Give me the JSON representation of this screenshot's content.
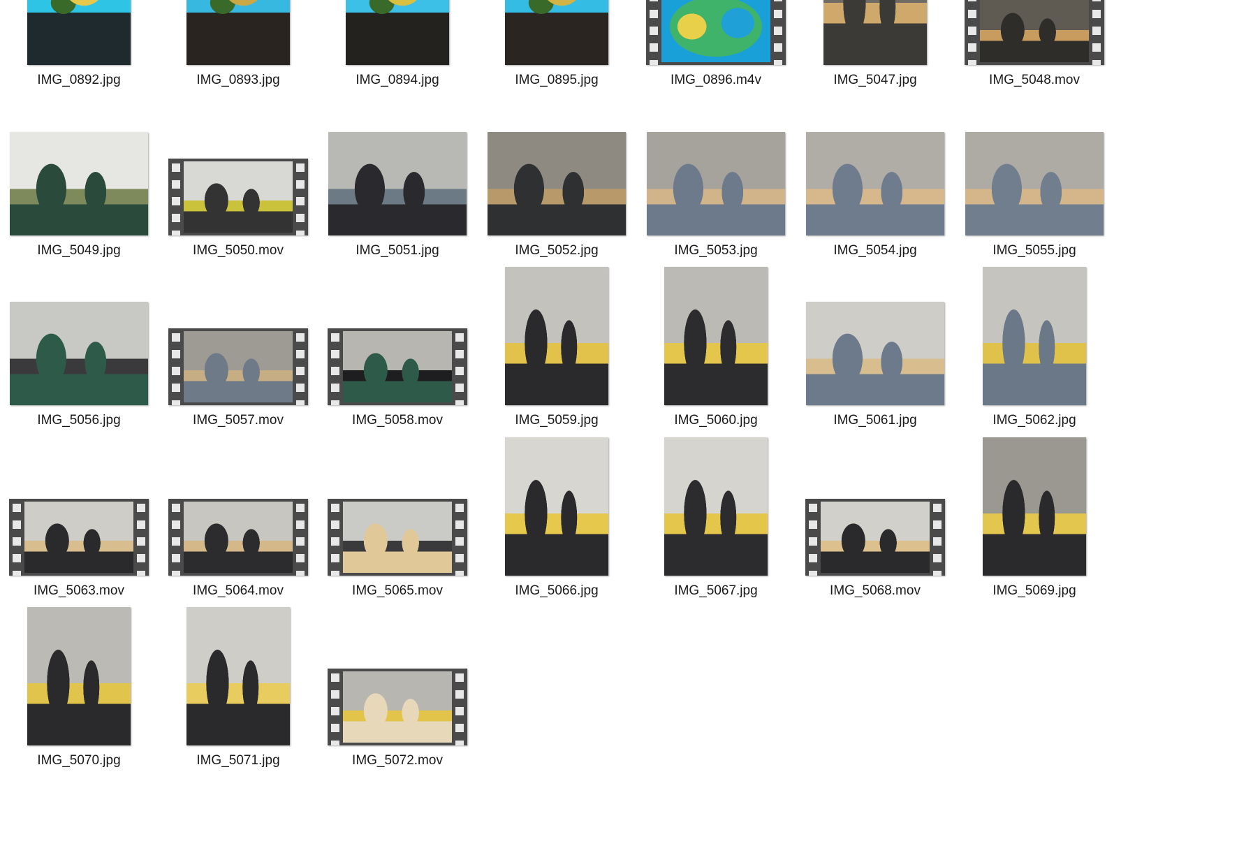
{
  "window": {
    "view": "Large icons"
  },
  "colors": {
    "background": "#ffffff",
    "label_text": "#1a1a1a",
    "filmstrip": "#4a4a4a"
  },
  "files": [
    {
      "name": "IMG_0892.jpg",
      "type": "image",
      "orientation": "portrait",
      "scene": "sandbox",
      "palette": [
        "#1f2a2e",
        "#2ec4e6",
        "#e6c84a"
      ]
    },
    {
      "name": "IMG_0893.jpg",
      "type": "image",
      "orientation": "portrait",
      "scene": "sandbox",
      "palette": [
        "#2a2420",
        "#36b8e0",
        "#caa844"
      ]
    },
    {
      "name": "IMG_0894.jpg",
      "type": "image",
      "orientation": "portrait",
      "scene": "sandbox",
      "palette": [
        "#24221f",
        "#3cc0e8",
        "#d9c041"
      ]
    },
    {
      "name": "IMG_0895.jpg",
      "type": "image",
      "orientation": "portrait",
      "scene": "sandbox",
      "palette": [
        "#2b2522",
        "#34bce4",
        "#d2b444"
      ]
    },
    {
      "name": "IMG_0896.m4v",
      "type": "video",
      "orientation": "landscape",
      "scene": "sandbox-top",
      "palette": [
        "#1aa0d8",
        "#e8d04a",
        "#3fb36a"
      ]
    },
    {
      "name": "IMG_5047.jpg",
      "type": "image",
      "orientation": "portrait",
      "scene": "office",
      "palette": [
        "#6e6a64",
        "#3c3a36",
        "#cfa86b"
      ]
    },
    {
      "name": "IMG_5048.mov",
      "type": "video",
      "orientation": "portrait",
      "scene": "office",
      "palette": [
        "#5f5a52",
        "#2e2d2a",
        "#c79c5e"
      ]
    },
    {
      "name": "IMG_5049.jpg",
      "type": "image",
      "orientation": "landscape",
      "scene": "office",
      "palette": [
        "#e6e6e2",
        "#2a4a3c",
        "#7e8a5c"
      ]
    },
    {
      "name": "IMG_5050.mov",
      "type": "video",
      "orientation": "landscape",
      "scene": "office",
      "palette": [
        "#d8d8d4",
        "#333333",
        "#c9c23a"
      ]
    },
    {
      "name": "IMG_5051.jpg",
      "type": "image",
      "orientation": "landscape",
      "scene": "office",
      "palette": [
        "#b8b8b4",
        "#2a2a2e",
        "#6c7a86"
      ]
    },
    {
      "name": "IMG_5052.jpg",
      "type": "image",
      "orientation": "landscape",
      "scene": "office",
      "palette": [
        "#8e8a82",
        "#2f3032",
        "#b89a6a"
      ]
    },
    {
      "name": "IMG_5053.jpg",
      "type": "image",
      "orientation": "landscape",
      "scene": "office",
      "palette": [
        "#a6a29c",
        "#6c7a8c",
        "#d2b48a"
      ]
    },
    {
      "name": "IMG_5054.jpg",
      "type": "image",
      "orientation": "landscape",
      "scene": "office",
      "palette": [
        "#b0aca6",
        "#6e7c8e",
        "#d6b88c"
      ]
    },
    {
      "name": "IMG_5055.jpg",
      "type": "image",
      "orientation": "landscape",
      "scene": "office",
      "palette": [
        "#aeaaa4",
        "#707e8e",
        "#d4b68a"
      ]
    },
    {
      "name": "IMG_5056.jpg",
      "type": "image",
      "orientation": "landscape",
      "scene": "office",
      "palette": [
        "#c8c8c4",
        "#2e5a4a",
        "#3a3a3c"
      ]
    },
    {
      "name": "IMG_5057.mov",
      "type": "video",
      "orientation": "landscape",
      "scene": "office",
      "palette": [
        "#9e9a94",
        "#6e7a88",
        "#c7ad84"
      ]
    },
    {
      "name": "IMG_5058.mov",
      "type": "video",
      "orientation": "landscape",
      "scene": "office",
      "palette": [
        "#b8b6b0",
        "#2e5a4a",
        "#1e1e20"
      ]
    },
    {
      "name": "IMG_5059.jpg",
      "type": "image",
      "orientation": "portrait",
      "scene": "office",
      "palette": [
        "#c4c2bc",
        "#2a2a2c",
        "#e2c24a"
      ]
    },
    {
      "name": "IMG_5060.jpg",
      "type": "image",
      "orientation": "portrait",
      "scene": "office",
      "palette": [
        "#bcbab4",
        "#2c2c2e",
        "#e4c64c"
      ]
    },
    {
      "name": "IMG_5061.jpg",
      "type": "image",
      "orientation": "landscape",
      "scene": "office",
      "palette": [
        "#cfcdc8",
        "#6c7a8c",
        "#d8bd8e"
      ]
    },
    {
      "name": "IMG_5062.jpg",
      "type": "image",
      "orientation": "portrait",
      "scene": "office",
      "palette": [
        "#c6c4be",
        "#6a7888",
        "#e0c24a"
      ]
    },
    {
      "name": "IMG_5063.mov",
      "type": "video",
      "orientation": "landscape",
      "scene": "office",
      "palette": [
        "#cfcdc8",
        "#2a2a2c",
        "#d8bd8e"
      ]
    },
    {
      "name": "IMG_5064.mov",
      "type": "video",
      "orientation": "landscape",
      "scene": "office",
      "palette": [
        "#c8c6c0",
        "#2c2c2e",
        "#d4b88a"
      ]
    },
    {
      "name": "IMG_5065.mov",
      "type": "video",
      "orientation": "landscape",
      "scene": "office",
      "palette": [
        "#cacac6",
        "#e0c898",
        "#3a3a3c"
      ]
    },
    {
      "name": "IMG_5066.jpg",
      "type": "image",
      "orientation": "portrait",
      "scene": "office",
      "palette": [
        "#d8d6d0",
        "#2a2a2c",
        "#e6c84c"
      ]
    },
    {
      "name": "IMG_5067.jpg",
      "type": "image",
      "orientation": "portrait",
      "scene": "office",
      "palette": [
        "#d6d4ce",
        "#2c2c2e",
        "#e4c64a"
      ]
    },
    {
      "name": "IMG_5068.mov",
      "type": "video",
      "orientation": "landscape",
      "scene": "office",
      "palette": [
        "#d2d0ca",
        "#2a2a2c",
        "#dcc08e"
      ]
    },
    {
      "name": "IMG_5069.jpg",
      "type": "image",
      "orientation": "portrait",
      "scene": "office",
      "palette": [
        "#9a9890",
        "#2a2a2c",
        "#e2c64e"
      ]
    },
    {
      "name": "IMG_5070.jpg",
      "type": "image",
      "orientation": "portrait",
      "scene": "office",
      "palette": [
        "#bcbab4",
        "#2a2a2c",
        "#e0c44c"
      ]
    },
    {
      "name": "IMG_5071.jpg",
      "type": "image",
      "orientation": "portrait",
      "scene": "office",
      "palette": [
        "#cfcdc8",
        "#2a2a2c",
        "#e8cc60"
      ]
    },
    {
      "name": "IMG_5072.mov",
      "type": "video",
      "orientation": "landscape",
      "scene": "office",
      "palette": [
        "#b8b6b0",
        "#e6d8b8",
        "#e2c44a"
      ]
    }
  ]
}
